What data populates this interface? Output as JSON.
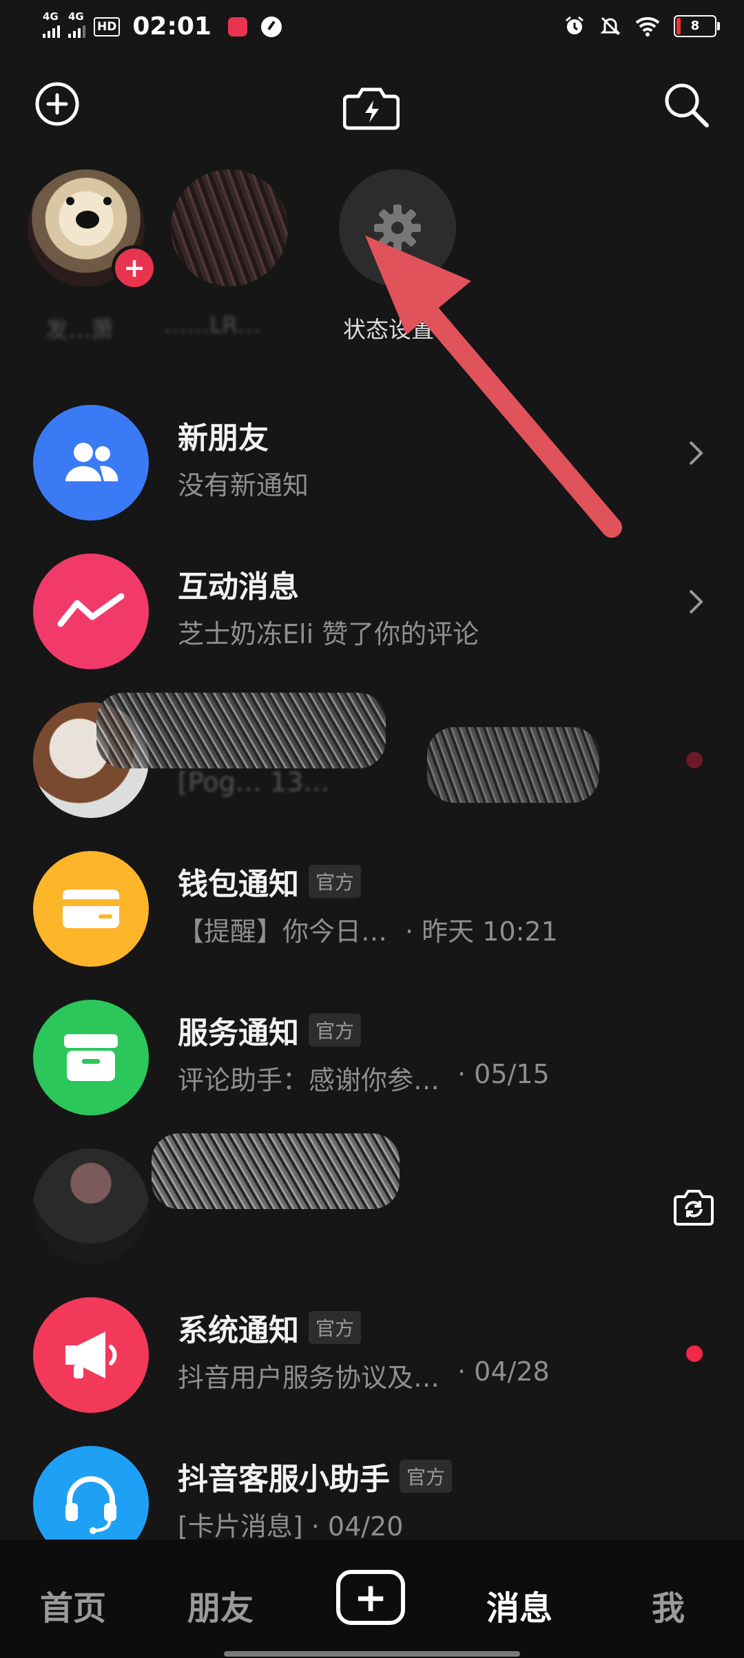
{
  "status_bar": {
    "signal1": "4G",
    "signal2": "4G",
    "hd": "HD",
    "time": "02:01",
    "battery": "8"
  },
  "stories": {
    "my_label": "发…萧",
    "friend_label": "……LR…",
    "status_label": "状态设置"
  },
  "messages": [
    {
      "title": "新朋友",
      "subtitle": "没有新通知",
      "icon": "friends-icon",
      "color": "#3a7bf5"
    },
    {
      "title": "互动消息",
      "subtitle": "芝士奶冻Eli 赞了你的评论",
      "icon": "zigzag-icon",
      "color": "#f23a6a"
    },
    {
      "title": "",
      "subtitle": "[Pog… 13…",
      "icon": "avatar"
    },
    {
      "title": "钱包通知",
      "tag": "官方",
      "subtitle": "【提醒】你今日…",
      "time": "· 昨天 10:21",
      "icon": "card-icon",
      "color": "#fdb52a"
    },
    {
      "title": "服务通知",
      "tag": "官方",
      "subtitle": "评论助手：感谢你参…",
      "time": "· 05/15",
      "icon": "box-icon",
      "color": "#2bc75a"
    },
    {
      "title": "",
      "subtitle": "",
      "icon": "avatar"
    },
    {
      "title": "系统通知",
      "tag": "官方",
      "subtitle": "抖音用户服务协议及…",
      "time": "· 04/28",
      "icon": "megaphone-icon",
      "color": "#f2395a"
    },
    {
      "title": "抖音客服小助手",
      "tag": "官方",
      "subtitle": "[卡片消息] · 04/20",
      "icon": "headset-icon",
      "color": "#1ea1f5"
    }
  ],
  "bottom_nav": {
    "home": "首页",
    "friends": "朋友",
    "create": "+",
    "messages": "消息",
    "me": "我"
  }
}
